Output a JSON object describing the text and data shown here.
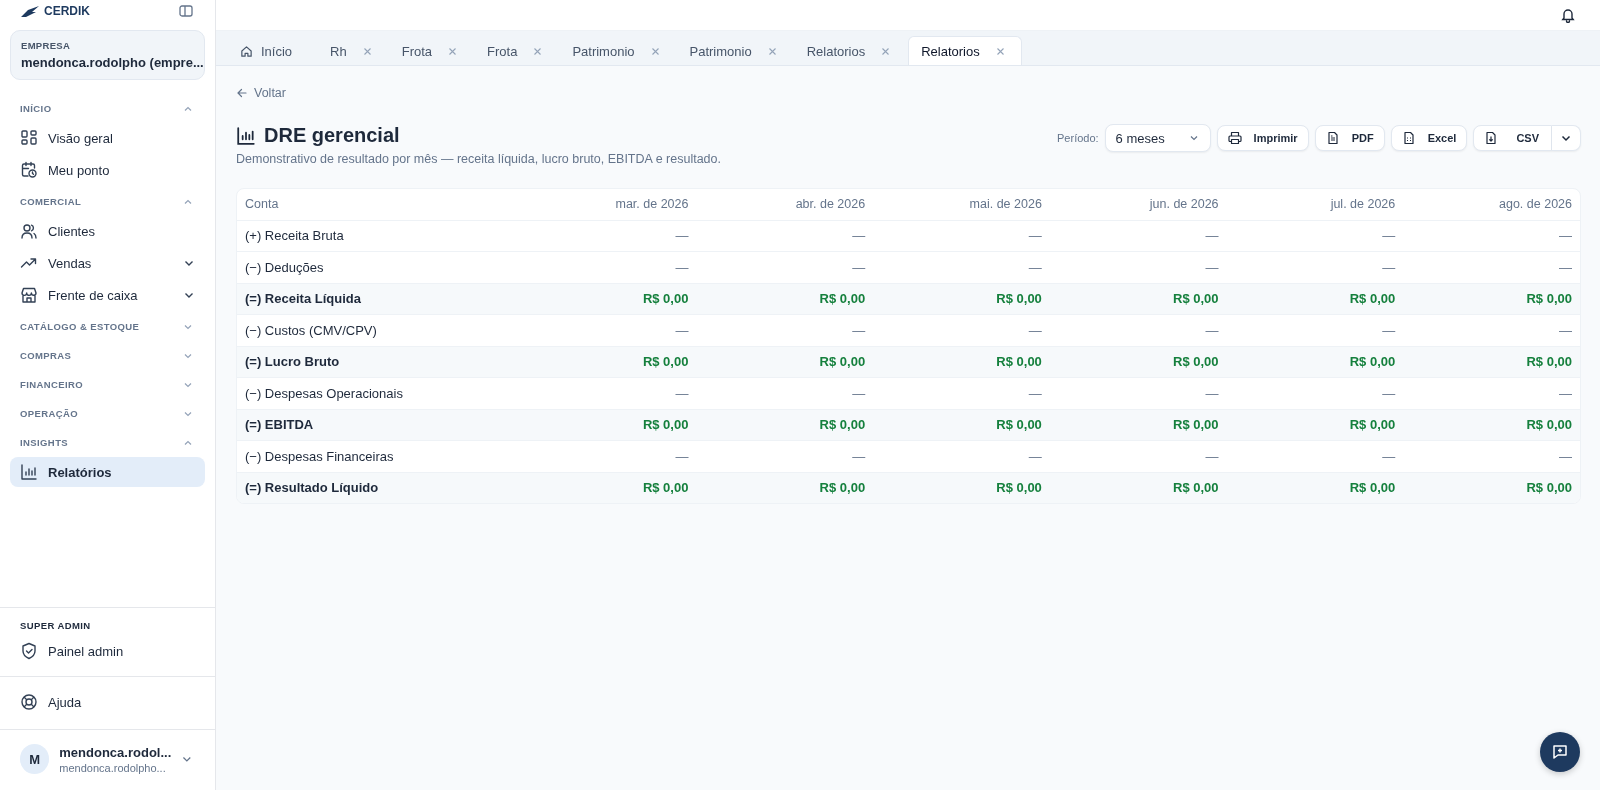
{
  "brand": {
    "name": "CERDIK"
  },
  "company": {
    "label": "EMPRESA",
    "name": "mendonca.rodolpho (empre..."
  },
  "sidebar": {
    "sections": [
      {
        "title": "INÍCIO",
        "expanded": true,
        "items": [
          {
            "label": "Visão geral",
            "selected": false,
            "submenu": false
          },
          {
            "label": "Meu ponto",
            "selected": false,
            "submenu": false
          }
        ]
      },
      {
        "title": "COMERCIAL",
        "expanded": true,
        "items": [
          {
            "label": "Clientes",
            "selected": false,
            "submenu": false
          },
          {
            "label": "Vendas",
            "selected": false,
            "submenu": true
          },
          {
            "label": "Frente de caixa",
            "selected": false,
            "submenu": true
          }
        ]
      },
      {
        "title": "CATÁLOGO & ESTOQUE",
        "expanded": false
      },
      {
        "title": "COMPRAS",
        "expanded": false
      },
      {
        "title": "FINANCEIRO",
        "expanded": false
      },
      {
        "title": "OPERAÇÃO",
        "expanded": false
      },
      {
        "title": "INSIGHTS",
        "expanded": true,
        "items": [
          {
            "label": "Relatórios",
            "selected": true,
            "submenu": false
          }
        ]
      }
    ],
    "admin": {
      "title": "SUPER ADMIN",
      "item": {
        "label": "Painel admin"
      }
    },
    "help": {
      "label": "Ajuda"
    },
    "user": {
      "initial": "M",
      "name": "mendonca.rodol...",
      "email": "mendonca.rodolpho..."
    }
  },
  "tabs": [
    {
      "label": "Início",
      "home": true,
      "closable": false,
      "selected": false
    },
    {
      "label": "Rh",
      "home": false,
      "closable": true,
      "selected": false
    },
    {
      "label": "Frota",
      "home": false,
      "closable": true,
      "selected": false
    },
    {
      "label": "Frota",
      "home": false,
      "closable": true,
      "selected": false
    },
    {
      "label": "Patrimonio",
      "home": false,
      "closable": true,
      "selected": false
    },
    {
      "label": "Patrimonio",
      "home": false,
      "closable": true,
      "selected": false
    },
    {
      "label": "Relatorios",
      "home": false,
      "closable": true,
      "selected": false
    },
    {
      "label": "Relatorios",
      "home": false,
      "closable": true,
      "selected": true
    }
  ],
  "back": "Voltar",
  "page": {
    "title": "DRE gerencial",
    "subtitle": "Demonstrativo de resultado por mês — receita líquida, lucro bruto, EBITDA e resultado."
  },
  "toolbar": {
    "period_label": "Período:",
    "period_value": "6 meses",
    "buttons": [
      {
        "label": "Imprimir"
      },
      {
        "label": "PDF"
      },
      {
        "label": "Excel"
      }
    ],
    "csv": {
      "label": "CSV"
    }
  },
  "table": {
    "columns": [
      "Conta",
      "mar. de 2026",
      "abr. de 2026",
      "mai. de 2026",
      "jun. de 2026",
      "jul. de 2026",
      "ago. de 2026"
    ],
    "rows": [
      {
        "kind": "item",
        "label": "(+) Receita Bruta",
        "values": [
          "—",
          "—",
          "—",
          "—",
          "—",
          "—"
        ]
      },
      {
        "kind": "item",
        "label": "(−) Deduções",
        "values": [
          "—",
          "—",
          "—",
          "—",
          "—",
          "—"
        ]
      },
      {
        "kind": "total",
        "label": "(=) Receita Líquida",
        "values": [
          "R$ 0,00",
          "R$ 0,00",
          "R$ 0,00",
          "R$ 0,00",
          "R$ 0,00",
          "R$ 0,00"
        ]
      },
      {
        "kind": "item",
        "label": "(−) Custos (CMV/CPV)",
        "values": [
          "—",
          "—",
          "—",
          "—",
          "—",
          "—"
        ]
      },
      {
        "kind": "total",
        "label": "(=) Lucro Bruto",
        "values": [
          "R$ 0,00",
          "R$ 0,00",
          "R$ 0,00",
          "R$ 0,00",
          "R$ 0,00",
          "R$ 0,00"
        ]
      },
      {
        "kind": "item",
        "label": "(−) Despesas Operacionais",
        "values": [
          "—",
          "—",
          "—",
          "—",
          "—",
          "—"
        ]
      },
      {
        "kind": "total",
        "label": "(=) EBITDA",
        "values": [
          "R$ 0,00",
          "R$ 0,00",
          "R$ 0,00",
          "R$ 0,00",
          "R$ 0,00",
          "R$ 0,00"
        ]
      },
      {
        "kind": "item",
        "label": "(−) Despesas Financeiras",
        "values": [
          "—",
          "—",
          "—",
          "—",
          "—",
          "—"
        ]
      },
      {
        "kind": "total",
        "label": "(=) Resultado Líquido",
        "values": [
          "R$ 0,00",
          "R$ 0,00",
          "R$ 0,00",
          "R$ 0,00",
          "R$ 0,00",
          "R$ 0,00"
        ]
      }
    ]
  }
}
